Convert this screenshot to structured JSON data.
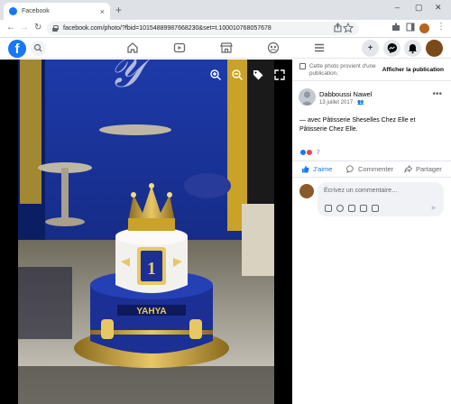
{
  "browser": {
    "tab_title": "Facebook",
    "tab_close": "×",
    "new_tab": "+",
    "url": "facebook.com/photo/?fbid=10154889987668230&set=t.100010768057678",
    "win_min": "–",
    "win_max": "▢",
    "win_close": "✕",
    "back": "←",
    "forward": "→",
    "reload": "↻"
  },
  "colors": {
    "fb_blue": "#1877f2",
    "like_blue": "#1877f2",
    "love_red": "#f33e58"
  },
  "photo": {
    "alt": "Royal blue and gold birthday cake with crown, number 1 and name YAHYA"
  },
  "cake": {
    "number": "1",
    "name": "YAHYA"
  },
  "notice": {
    "text": "Cette photo provient d'une publication.",
    "action": "Afficher la publication"
  },
  "post": {
    "author": "Dabboussi Nawel",
    "date": "13 juillet 2017 ·",
    "more": "•••",
    "caption": "— avec Pâtisserie Sheselles Chez Elle et Pâtisserie Chez Elle.",
    "reaction_count": "7"
  },
  "actions": {
    "like": "J'aime",
    "comment": "Commenter",
    "share": "Partager"
  },
  "comment": {
    "placeholder": "Écrivez un commentaire…",
    "send": "➤"
  }
}
